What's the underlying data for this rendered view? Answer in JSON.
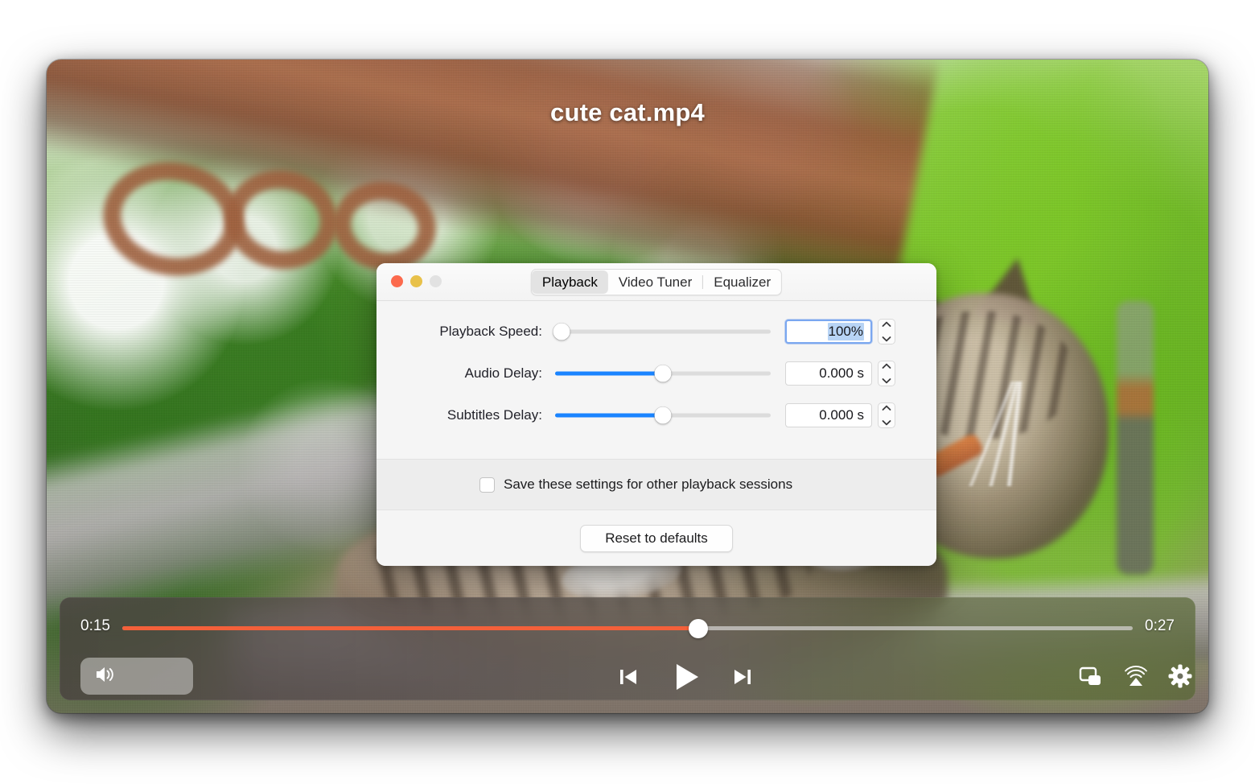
{
  "player": {
    "video_title": "cute cat.mp4",
    "time_current": "0:15",
    "time_total": "0:27",
    "progress_percent": 57,
    "icons": {
      "volume": "speaker-volume-icon",
      "previous": "previous-track-icon",
      "play": "play-icon",
      "next": "next-track-icon",
      "pip": "picture-in-picture-icon",
      "airplay": "airplay-icon",
      "settings": "gear-icon",
      "playlist": "playlist-icon"
    },
    "accent_color": "#f4603a"
  },
  "dialog": {
    "window_controls": {
      "close": "close-button",
      "minimize": "minimize-button",
      "zoom": "zoom-button"
    },
    "tabs": [
      {
        "label": "Playback",
        "selected": true
      },
      {
        "label": "Video Tuner",
        "selected": false
      },
      {
        "label": "Equalizer",
        "selected": false
      }
    ],
    "settings": [
      {
        "label": "Playback Speed:",
        "value": "100%",
        "slider_percent": 3,
        "focused": true
      },
      {
        "label": "Audio Delay:",
        "value": "0.000 s",
        "slider_percent": 50,
        "focused": false
      },
      {
        "label": "Subtitles Delay:",
        "value": "0.000 s",
        "slider_percent": 50,
        "focused": false
      }
    ],
    "save_checkbox": {
      "label": "Save these settings for other playback sessions",
      "checked": false
    },
    "reset_button_label": "Reset to defaults",
    "accent_color": "#1a84ff",
    "focus_ring_color": "#7aa7f0"
  }
}
